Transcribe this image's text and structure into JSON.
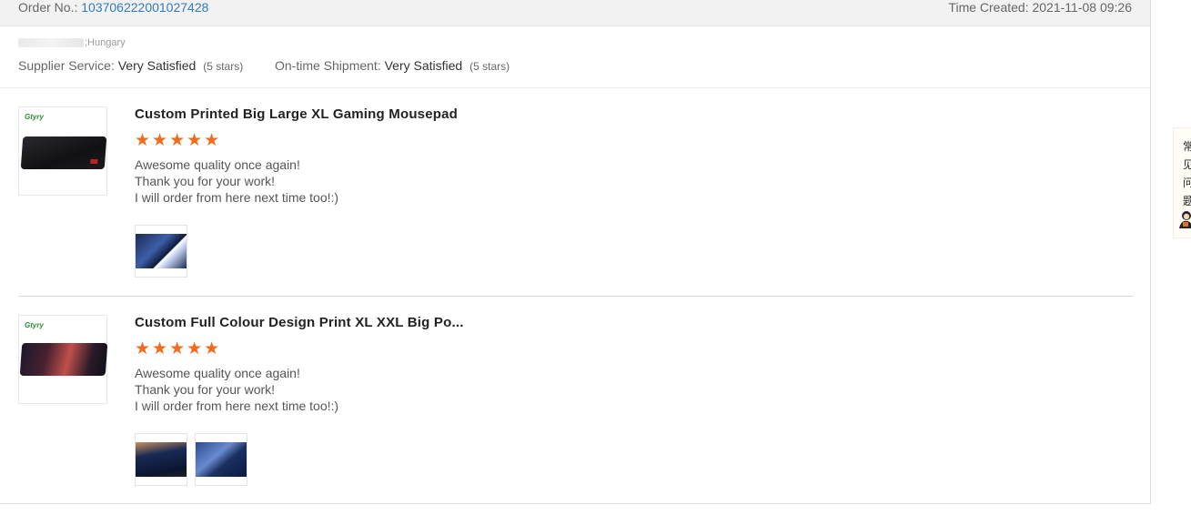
{
  "order": {
    "label": "Order No.:",
    "number": "103706222001027428",
    "time_created": "Time Created: 2021-11-08 09:26"
  },
  "buyer": {
    "country": ";Hungary"
  },
  "ratings": {
    "supplier_label": "Supplier Service:",
    "supplier_value": "Very Satisfied",
    "supplier_stars": "(5 stars)",
    "shipment_label": "On-time Shipment:",
    "shipment_value": "Very Satisfied",
    "shipment_stars": "(5 stars)"
  },
  "reviews": [
    {
      "title": "Custom Printed Big Large XL Gaming Mousepad",
      "stars": "★★★★★",
      "rating": 5,
      "lines": [
        "Awesome quality once again!",
        "Thank you for your work!",
        "I will order from here next time too!:)"
      ],
      "logo": "Gtyry"
    },
    {
      "title": "Custom Full Colour Design Print XL XXL Big Po...",
      "stars": "★★★★★",
      "rating": 5,
      "lines": [
        "Awesome quality once again!",
        "Thank you for your work!",
        "I will order from here next time too!:)"
      ],
      "logo": "Gtyry"
    }
  ],
  "help_tab": {
    "text": "常见问题",
    "avatar_icon": "customer-service-avatar-icon"
  },
  "colors": {
    "star": "#f26b1d",
    "link": "#2f7cc0",
    "header_bg": "#f2f2f2"
  }
}
